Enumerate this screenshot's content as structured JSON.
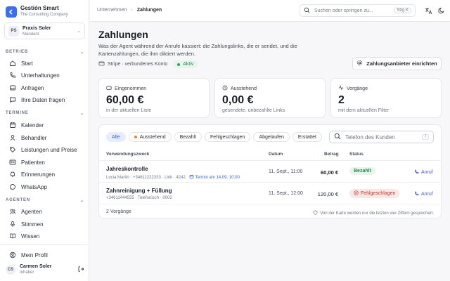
{
  "brand": {
    "name": "Gestión Smart",
    "subtitle": "The Consulting Company",
    "logo_icon": "arrow-left-icon"
  },
  "tenant": {
    "initials": "PS",
    "name": "Praxis Soler",
    "role": "Mandant"
  },
  "sidebar": {
    "sections": [
      {
        "label": "BETRIEB",
        "items": [
          {
            "label": "Start",
            "icon": "home-icon"
          },
          {
            "label": "Unterhaltungen",
            "icon": "phone-icon"
          },
          {
            "label": "Anfragen",
            "icon": "inbox-icon"
          },
          {
            "label": "Ihre Daten fragen",
            "icon": "chat-icon"
          }
        ]
      },
      {
        "label": "TERMINE",
        "items": [
          {
            "label": "Kalender",
            "icon": "calendar-icon"
          },
          {
            "label": "Behandler",
            "icon": "user-icon"
          },
          {
            "label": "Leistungen und Preise",
            "icon": "tag-icon"
          },
          {
            "label": "Patienten",
            "icon": "id-card-icon"
          },
          {
            "label": "Erinnerungen",
            "icon": "bell-icon"
          },
          {
            "label": "WhatsApp",
            "icon": "whatsapp-icon"
          }
        ]
      },
      {
        "label": "AGENTEN",
        "items": [
          {
            "label": "Agenten",
            "icon": "users-icon"
          },
          {
            "label": "Stimmen",
            "icon": "mic-icon"
          },
          {
            "label": "Wissen",
            "icon": "book-icon"
          }
        ]
      }
    ],
    "profile_label": "Mein Profil",
    "user": {
      "initials": "CS",
      "name": "Carmen Soler",
      "role": "Inhaber"
    }
  },
  "topbar": {
    "breadcrumb": [
      "Unternehmen",
      "Zahlungen"
    ],
    "search_placeholder": "Suchen oder springen zu...",
    "search_shortcut": "Strg K"
  },
  "page": {
    "title": "Zahlungen",
    "description": "Was der Agent während der Anrufe kassiert: die Zahlungslinks, die er sendet, und die Kartenzahlungen, die ihm diktiert werden.",
    "connection_label": "Stripe · verbundenes Konto",
    "connection_status": "Aktiv",
    "provider_button": "Zahlungsanbieter einrichten"
  },
  "stats": [
    {
      "label": "Eingenommen",
      "value": "60,00 €",
      "sub": "in der aktuellen Liste",
      "icon": "wallet-icon"
    },
    {
      "label": "Ausstehend",
      "value": "0,00 €",
      "sub": "gesendete, unbezahlte Links",
      "icon": "clock-icon"
    },
    {
      "label": "Vorgänge",
      "value": "2",
      "sub": "mit dem aktuellen Filter",
      "icon": "activity-icon"
    }
  ],
  "filters": [
    "Alle",
    "Ausstehend",
    "Bezahlt",
    "Fehlgeschlagen",
    "Abgelaufen",
    "Erstattet"
  ],
  "table": {
    "search_placeholder": "Telefon des Kunden",
    "search_shortcut": "/",
    "columns": [
      "Verwendungszweck",
      "Datum",
      "Betrag",
      "Status"
    ],
    "rows": [
      {
        "title": "Jahreskontrolle",
        "meta": "Lucia Martin · +34611222333 · Link · 4242",
        "link": "Termin am 14.09. 10:00",
        "date": "11. Sept., 11:00",
        "amount": "60,00 €",
        "status": "Bezahlt",
        "action": "Anruf"
      },
      {
        "title": "Zahnreinigung + Füllung",
        "meta": "+34611444555 · Telefonisch · 0002",
        "link": "",
        "date": "11. Sept., 12:00",
        "amount": "120,00 €",
        "status": "Fehlgeschlagen",
        "action": "Anruf"
      }
    ],
    "footer_count": "2 Vorgänge",
    "footer_note": "Von der Karte werden nur die letzten vier Ziffern gespeichert."
  },
  "colors": {
    "accent": "#3b6ff2",
    "success": "#1f8a4c",
    "danger": "#c0392b",
    "warning": "#e08a1e"
  }
}
